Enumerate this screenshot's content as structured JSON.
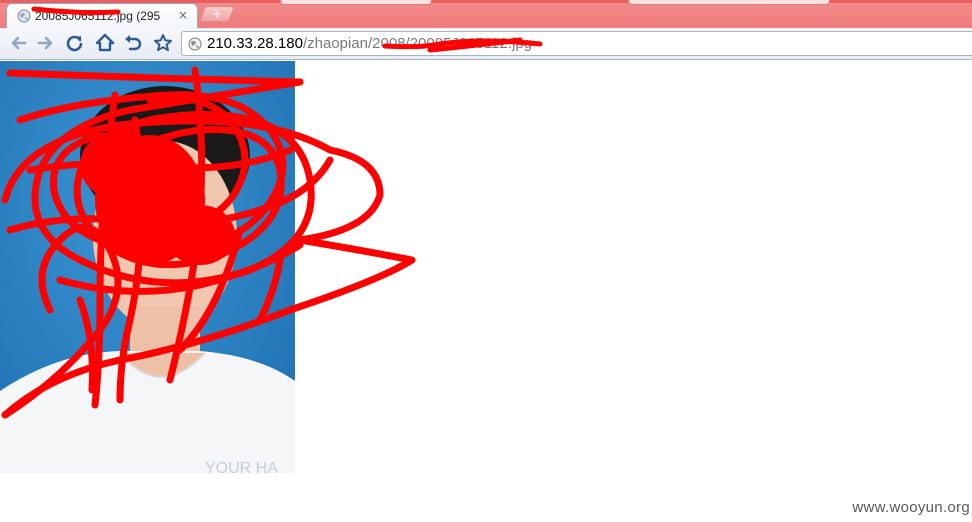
{
  "tab": {
    "title": "20085J065112.jpg (295",
    "close_glyph": "×",
    "favicon": "globe-icon"
  },
  "newtab": {
    "glyph": "+"
  },
  "toolbar": {
    "back": "back-arrow-icon",
    "forward": "forward-arrow-icon",
    "reload": "reload-icon",
    "home": "home-icon",
    "undo": "undo-icon",
    "bookmark": "star-icon"
  },
  "omnibox": {
    "host": "210.33.28.180",
    "path": "/zhaopian/2008/20085J065112.jpg"
  },
  "photo": {
    "overlay_text": "YOUR HA"
  },
  "watermark": "www.wooyun.org",
  "colors": {
    "tabstrip": "#ef7b7b",
    "scribble": "#ff0000",
    "photo_background": "#2c83c6",
    "toolbar": "#eef2f7"
  }
}
